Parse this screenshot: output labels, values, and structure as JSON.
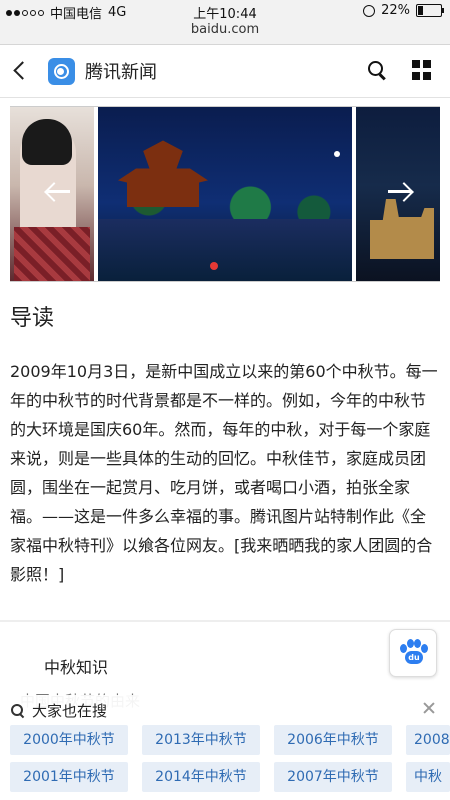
{
  "status_bar": {
    "carrier": "中国电信",
    "network": "4G",
    "time": "上午10:44",
    "battery": "22%",
    "battery_level": 0.22,
    "url": "baidu.com"
  },
  "nav": {
    "title": "腾讯新闻"
  },
  "article": {
    "section_title": "导读",
    "intro": "2009年10月3日，是新中国成立以来的第60个中秋节。每一年的中秋节的时代背景都是不一样的。例如，今年的中秋节的大环境是国庆60年。然而，每年的中秋，对于每一个家庭来说，则是一些具体的生动的回忆。中秋佳节，家庭成员团圆，围坐在一起赏月、吃月饼，或者喝口小酒，拍张全家福。——这是一件多么幸福的事。腾讯图片站特制作此《全家福中秋特刊》以飨各位网友。[我来晒晒我的家人团圆的合影照！]",
    "knowledge_title": "中秋知识",
    "knowledge_sub": "中国中秋节的由来"
  },
  "baidu_button": {
    "label": "du"
  },
  "suggestions": {
    "header": "大家也在搜",
    "row1": [
      "2000年中秋节",
      "2013年中秋节",
      "2006年中秋节",
      "2008"
    ],
    "row2": [
      "2001年中秋节",
      "2014年中秋节",
      "2007年中秋节",
      "中秋"
    ]
  }
}
